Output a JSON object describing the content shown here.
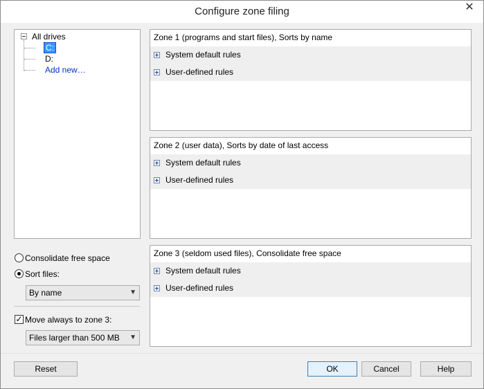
{
  "window": {
    "title": "Configure zone filing",
    "close_glyph": "✕"
  },
  "tree": {
    "root": "All drives",
    "drives": [
      "C:",
      "D:"
    ],
    "add_new": "Add new…"
  },
  "zones": [
    {
      "header": "Zone 1 (programs and start files), Sorts by name",
      "rules": [
        "System default rules",
        "User-defined rules"
      ]
    },
    {
      "header": "Zone 2 (user data), Sorts by date of last access",
      "rules": [
        "System default rules",
        "User-defined rules"
      ]
    },
    {
      "header": "Zone 3 (seldom used files), Consolidate free space",
      "rules": [
        "System default rules",
        "User-defined rules"
      ]
    }
  ],
  "options": {
    "consolidate_label": "Consolidate free space",
    "sort_label": "Sort files:",
    "sort_selected": "By name",
    "move_label": "Move always to zone 3:",
    "move_checked": true,
    "move_selected": "Files larger than 500 MB",
    "check_glyph": "✓",
    "arrow_glyph": "▼"
  },
  "buttons": {
    "reset": "Reset",
    "ok": "OK",
    "cancel": "Cancel",
    "help": "Help"
  }
}
